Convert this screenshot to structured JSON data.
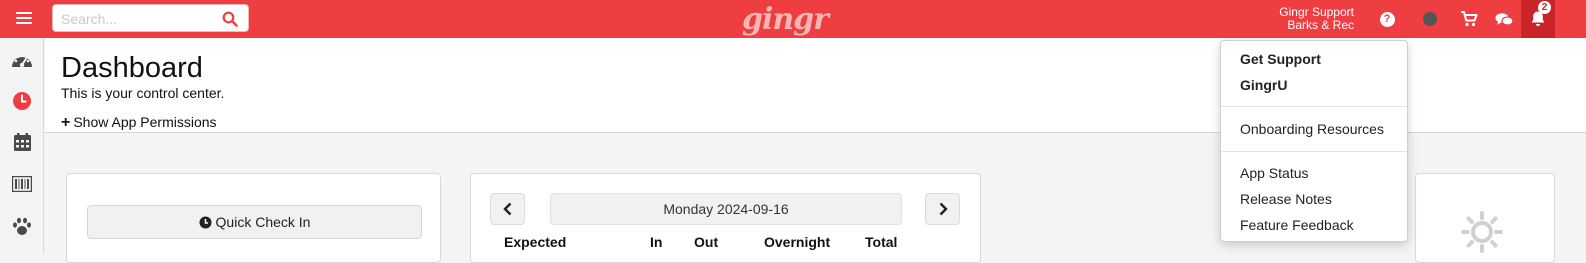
{
  "topbar": {
    "search_placeholder": "Search...",
    "logo_text": "gingr",
    "user_name": "Gingr Support",
    "location_name": "Barks & Rec",
    "notification_count": "2",
    "icons": [
      "menu-icon",
      "search-icon",
      "help-icon",
      "status-dot",
      "cart-icon",
      "chat-icon",
      "bell-icon"
    ],
    "accent_color": "#ee3e42"
  },
  "sidebar": {
    "items": [
      {
        "icon": "dashboard-gauge-icon"
      },
      {
        "icon": "clock-icon",
        "active": true
      },
      {
        "icon": "calendar-icon"
      },
      {
        "icon": "barcode-icon"
      },
      {
        "icon": "paw-icon"
      }
    ]
  },
  "header": {
    "title": "Dashboard",
    "subtitle": "This is your control center.",
    "permissions_link": "Show App Permissions"
  },
  "quick_check_in": {
    "button_label": "Quick Check In"
  },
  "calendar": {
    "date_label": "Monday 2024-09-16",
    "columns": [
      "Expected",
      "In",
      "Out",
      "Overnight",
      "Total"
    ]
  },
  "support_menu": {
    "items": [
      {
        "label": "Get Support",
        "bold": true
      },
      {
        "label": "GingrU",
        "bold": true
      },
      {
        "label": "Onboarding Resources",
        "bold": false
      },
      {
        "label": "App Status",
        "bold": false
      },
      {
        "label": "Release Notes",
        "bold": false
      },
      {
        "label": "Feature Feedback",
        "bold": false
      }
    ]
  }
}
